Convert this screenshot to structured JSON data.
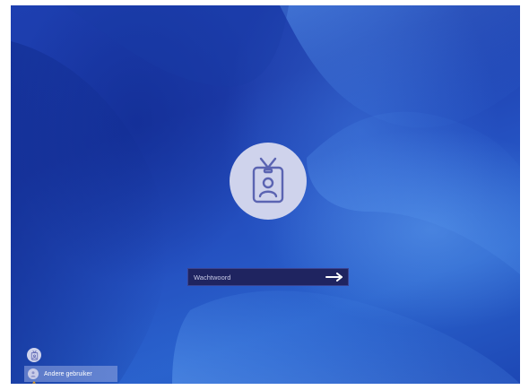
{
  "login": {
    "password_placeholder": "Wachtwoord"
  },
  "user_switcher": {
    "other_user_label": "Andere gebruiker"
  },
  "icons": {
    "avatar": "id-badge-person-icon",
    "submit": "arrow-right-icon",
    "small_user": "id-badge-person-icon",
    "other_user": "person-icon"
  },
  "colors": {
    "background": "#1f47b8",
    "avatar_circle": "#cfd3ec",
    "icon_stroke": "#5b64b2",
    "password_box": "#1f2460",
    "cursor": "#e6a020"
  }
}
